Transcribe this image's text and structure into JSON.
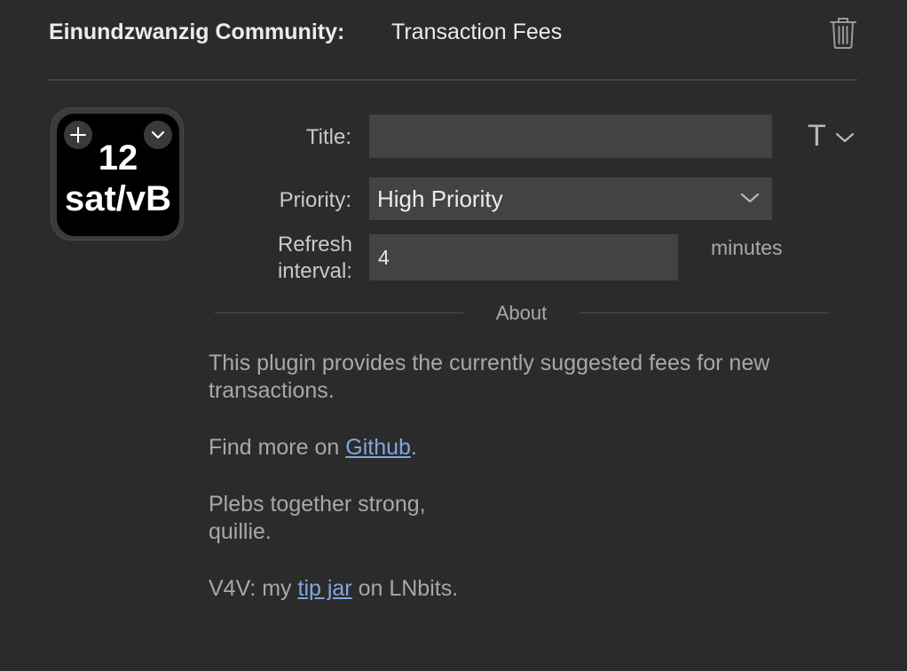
{
  "header": {
    "plugin_name": "Einundzwanzig Community:",
    "action_name": "Transaction Fees"
  },
  "preview": {
    "line1": "12",
    "line2": "sat/vB"
  },
  "form": {
    "title_label": "Title:",
    "title_value": "",
    "font_button_glyph": "T",
    "priority_label": "Priority:",
    "priority_value": "High Priority",
    "refresh_label_line1": "Refresh",
    "refresh_label_line2": "interval:",
    "refresh_value": "4",
    "refresh_units": "minutes"
  },
  "about": {
    "heading": "About",
    "paragraph1": "This plugin provides the currently suggested fees for new transactions.",
    "paragraph2_before": "Find more on ",
    "paragraph2_link": "Github",
    "paragraph2_after": ".",
    "paragraph3_line1": "Plebs together strong,",
    "paragraph3_line2": "quillie.",
    "paragraph4_before": "V4V: my ",
    "paragraph4_link": "tip jar",
    "paragraph4_after": " on LNbits."
  },
  "colors": {
    "background": "#2b2b2b",
    "field": "#434343",
    "link": "#7fa6e0",
    "key_background": "#000000"
  },
  "icons": {
    "delete": "trash-icon",
    "add": "plus-icon",
    "menu": "chevron-down-icon",
    "font": "font-style-icon"
  }
}
